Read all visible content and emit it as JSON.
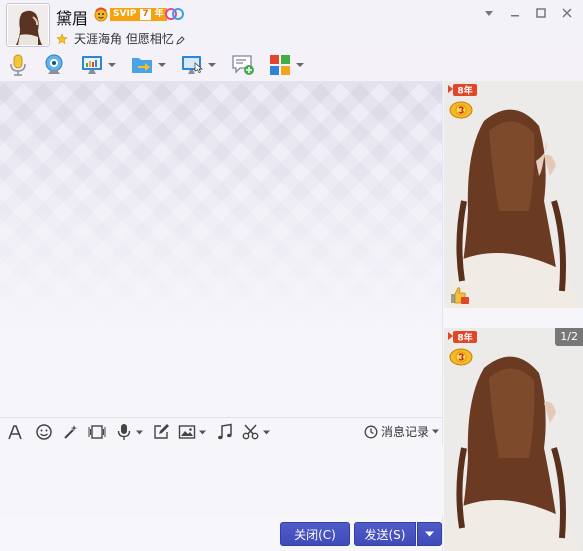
{
  "header": {
    "nickname": "黛眉",
    "vip_text": "SVIP",
    "vip_level": "7",
    "vip_year": "年",
    "signature": "天涯海角 但愿相忆"
  },
  "toolbar": {
    "items": [
      "voice-call",
      "video-call",
      "screen-share",
      "file-transfer",
      "remote-assist",
      "new-discussion",
      "app-box"
    ]
  },
  "input_toolbar": {
    "history_label": "消息记录"
  },
  "buttons": {
    "close_label": "关闭(C)",
    "send_label": "发送(S)"
  },
  "right_panel": {
    "year_badge_text": "8年",
    "page_indicator": "1/2"
  },
  "colors": {
    "accent": "#4450bf",
    "vip_orange": "#f5a20e",
    "background": "#f6f5fa"
  }
}
